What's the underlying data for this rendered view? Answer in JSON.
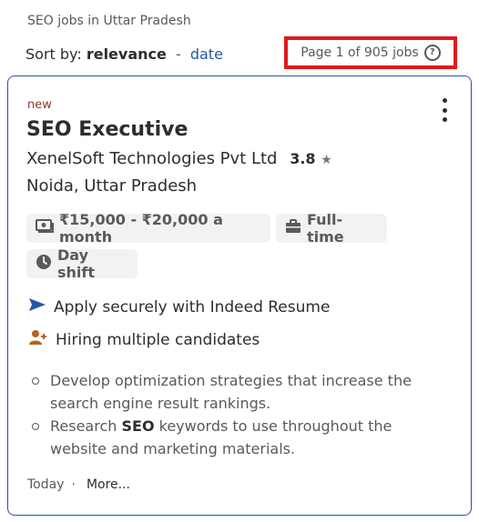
{
  "header": {
    "breadcrumb": "SEO jobs in Uttar Pradesh",
    "sort_label": "Sort by:",
    "sort_relevance": "relevance",
    "sort_separator": "-",
    "sort_date": "date",
    "page_count": "Page 1 of 905 jobs"
  },
  "job": {
    "new_tag": "new",
    "title": "SEO Executive",
    "company": "XenelSoft Technologies Pvt Ltd",
    "rating": "3.8",
    "location": "Noida, Uttar Pradesh",
    "salary": "₹15,000 - ₹20,000 a month",
    "job_type": "Full-time",
    "shift": "Day shift",
    "feature_apply": "Apply securely with Indeed Resume",
    "feature_hiring": "Hiring multiple candidates",
    "bullet_1": "Develop optimization strategies that increase the search engine result rankings.",
    "bullet_2_before": "Research ",
    "bullet_2_bold": "SEO",
    "bullet_2_after": " keywords to use throughout the website and marketing materials.",
    "posted": "Today",
    "dot": "·",
    "more": "More..."
  },
  "icons": {
    "help": "help-circle-icon",
    "menu": "more-vertical-icon",
    "star": "star-icon",
    "salary": "money-icon",
    "job_type": "briefcase-icon",
    "shift": "clock-icon",
    "apply": "send-arrow-icon",
    "hiring": "person-add-icon"
  },
  "colors": {
    "link": "#2557a7",
    "highlight_box": "#e01a1a",
    "new_tag": "#8a3a2a",
    "hiring_icon": "#b5651d",
    "chip_bg": "#f3f2f1"
  }
}
